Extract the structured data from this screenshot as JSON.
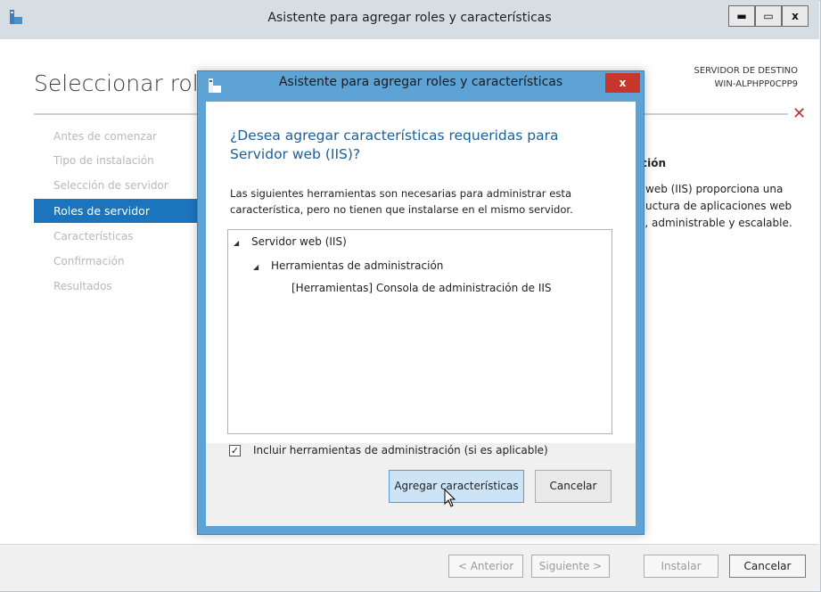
{
  "window": {
    "title": "Asistente para agregar roles y características",
    "minimize_glyph": "▬",
    "maximize_glyph": "▭",
    "close_glyph": "x"
  },
  "page": {
    "heading": "Seleccionar role",
    "dest_label": "SERVIDOR DE DESTINO",
    "dest_server": "WIN-ALPHPP0CPP9",
    "red_x": "✕"
  },
  "nav": {
    "items": [
      {
        "label": "Antes de comenzar"
      },
      {
        "label": "Tipo de instalación"
      },
      {
        "label": "Selección de servidor"
      },
      {
        "label": "Roles de servidor"
      },
      {
        "label": "Características"
      },
      {
        "label": "Confirmación"
      },
      {
        "label": "Resultados"
      }
    ]
  },
  "description": {
    "title": "ción",
    "lines": [
      "web (IIS) proporciona una",
      "uctura de aplicaciones web",
      "e, administrable y escalable."
    ]
  },
  "footer": {
    "prev": "< Anterior",
    "next": "Siguiente >",
    "install": "Instalar",
    "cancel": "Cancelar"
  },
  "dialog": {
    "title": "Asistente para agregar roles y características",
    "close_glyph": "x",
    "question": "¿Desea agregar características requeridas para Servidor web (IIS)?",
    "text_line1": "Las siguientes herramientas son necesarias para administrar esta",
    "text_line2": "característica, pero no tienen que instalarse en el mismo servidor.",
    "tree": [
      {
        "label": "Servidor web (IIS)"
      },
      {
        "label": "Herramientas de administración"
      },
      {
        "label": "[Herramientas] Consola de administración de IIS"
      }
    ],
    "tree_expander": "◢",
    "checkbox_checked": true,
    "checkbox_glyph": "✓",
    "checkbox_label": "Incluir herramientas de administración (si es aplicable)",
    "add_button": "Agregar características",
    "cancel_button": "Cancelar"
  },
  "colors": {
    "accent": "#1c75bc",
    "dialog_border": "#5da3d6",
    "close_red": "#c7352b"
  }
}
